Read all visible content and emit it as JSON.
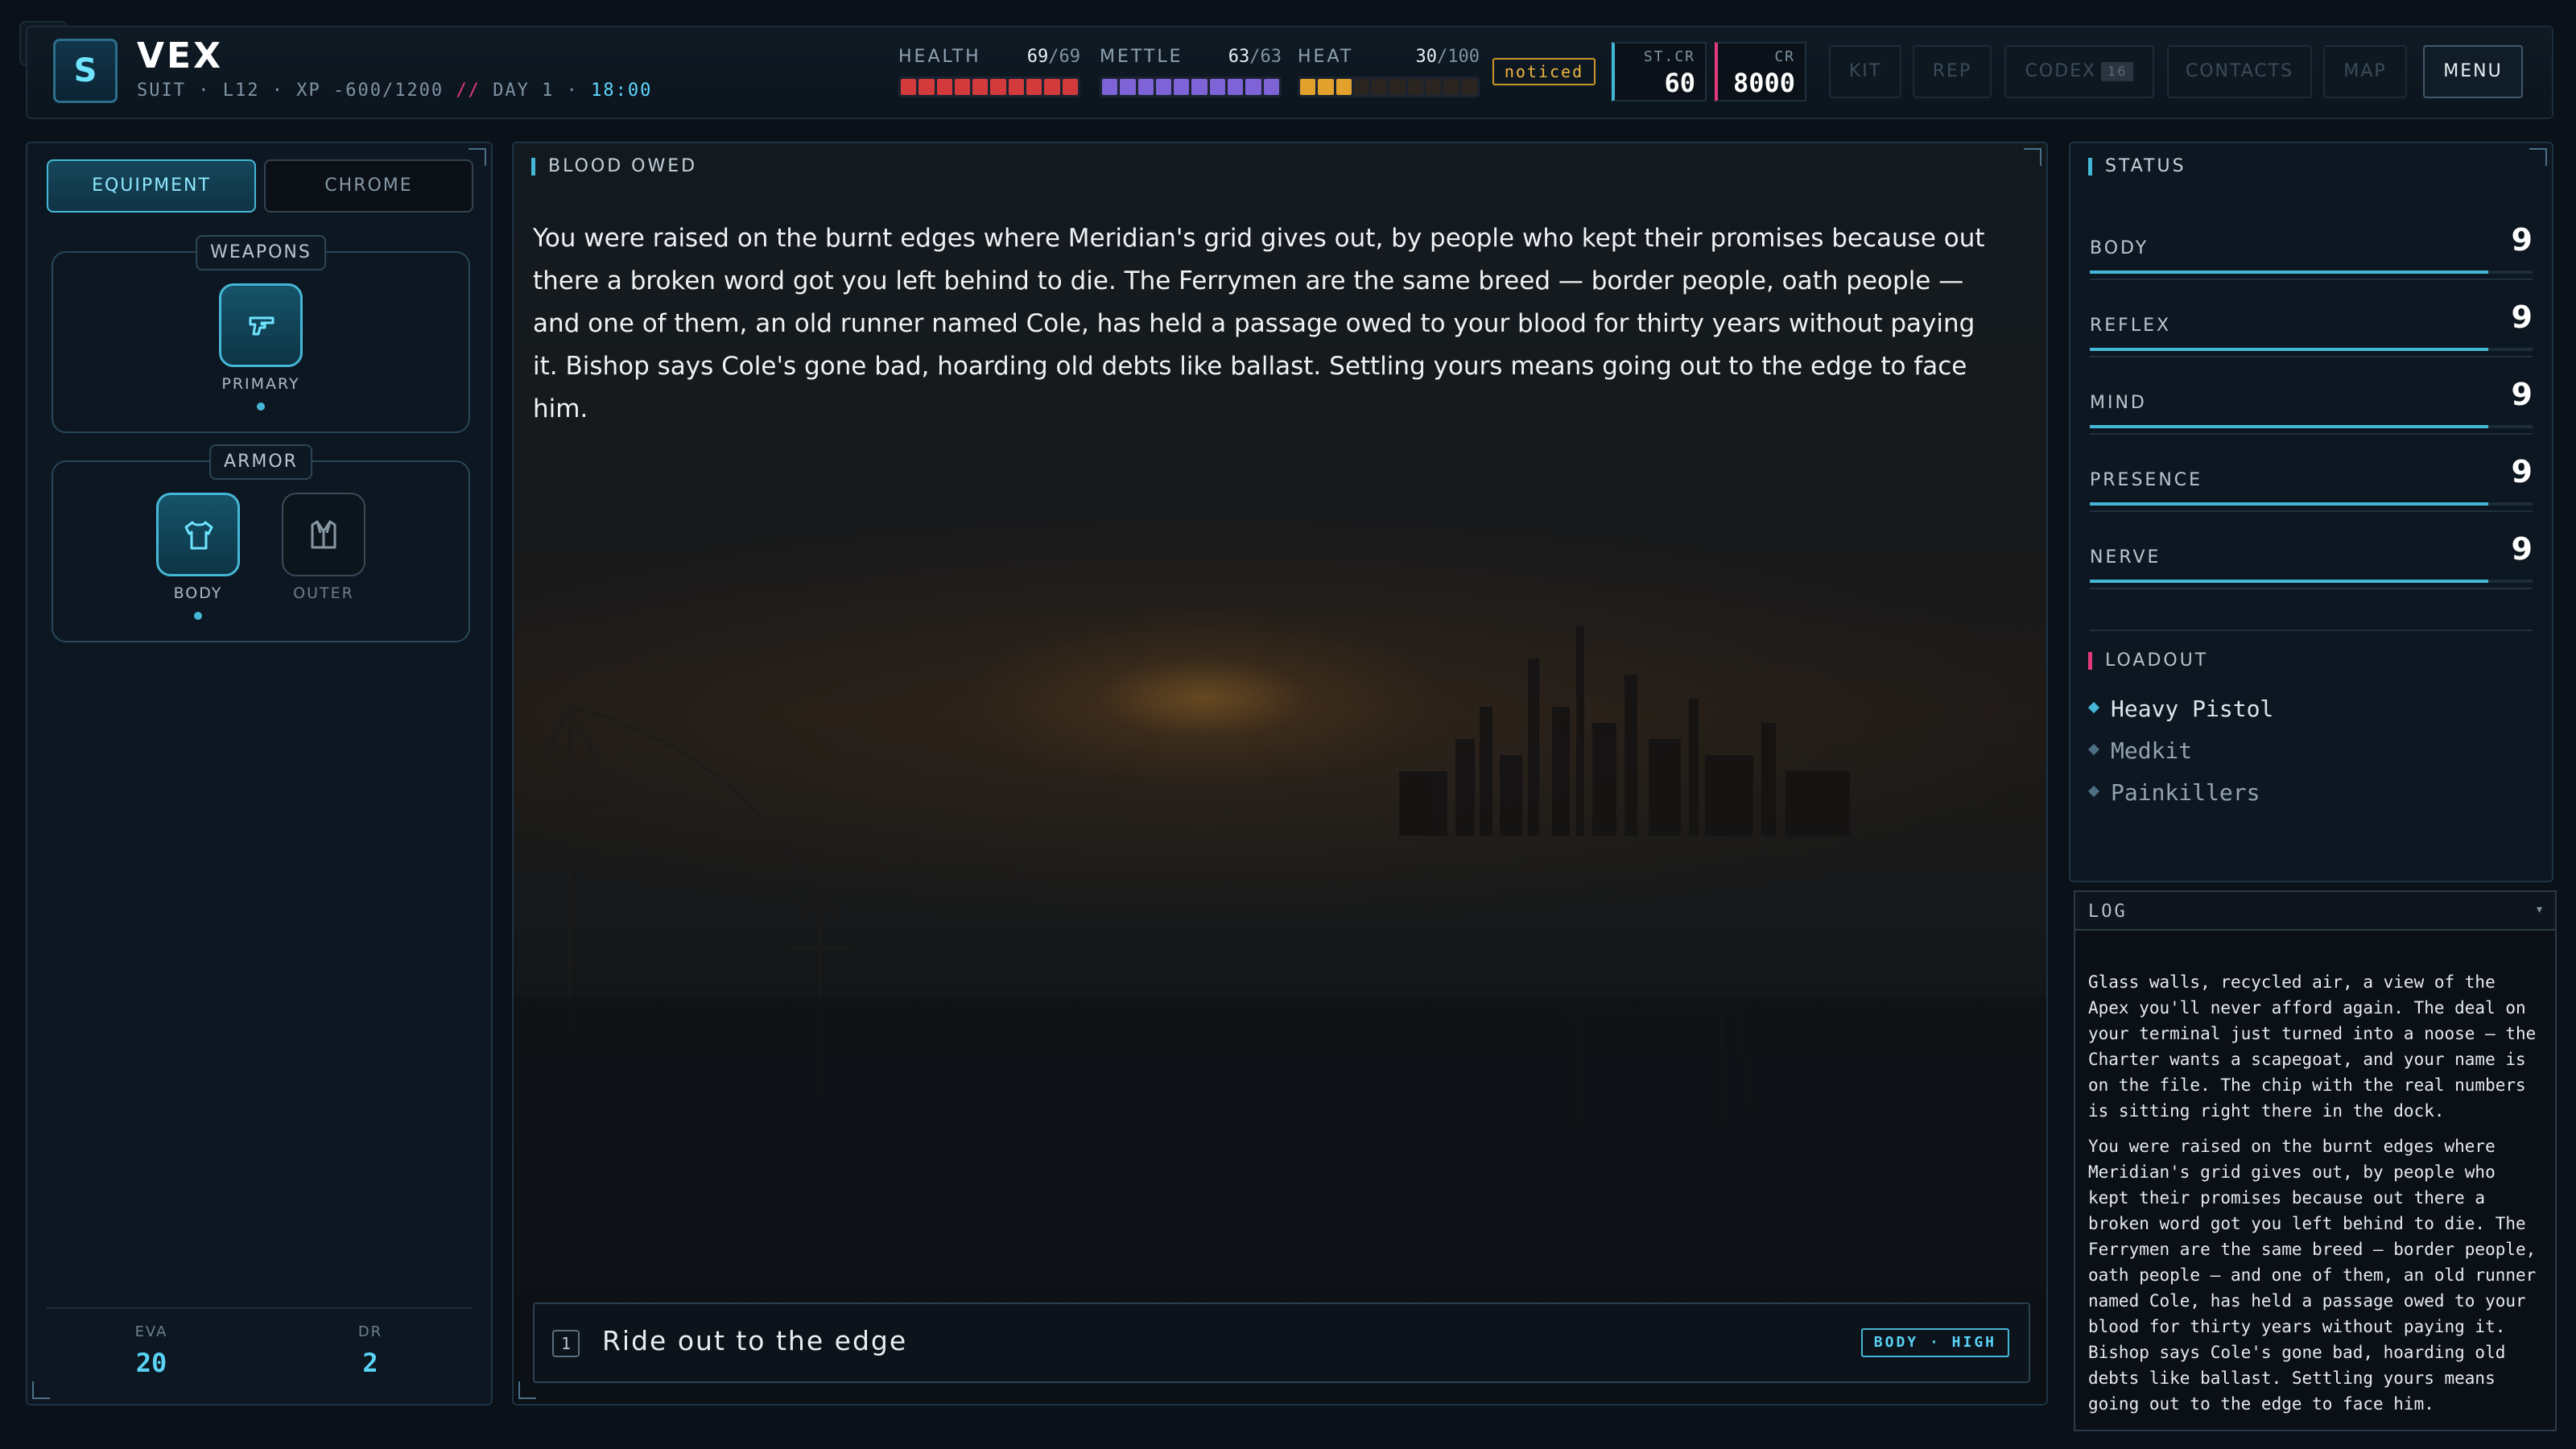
{
  "header": {
    "bug_icon": "bug-icon",
    "logo_letter": "S",
    "name": "VEX",
    "meta": {
      "class": "SUIT",
      "level": "L12",
      "xp": "XP -600/1200",
      "slashes": "//",
      "day": "DAY 1",
      "time": "18:00",
      "sep": "·"
    },
    "meters": [
      {
        "label": "HEALTH",
        "current": "69",
        "max": "/69",
        "fill": 1.0,
        "color": "#d23a3c"
      },
      {
        "label": "METTLE",
        "current": "63",
        "max": "/63",
        "fill": 1.0,
        "color": "#7d63d6"
      },
      {
        "label": "HEAT",
        "current": "30",
        "max": "/100",
        "fill": 0.3,
        "color": "#e2a12b"
      }
    ],
    "heat_status": "noticed",
    "street_cred": {
      "label": "ST.CR",
      "value": "60",
      "accent": "#45b7d6"
    },
    "credits": {
      "label": "CR",
      "value": "8000",
      "accent": "#e23a7a"
    },
    "nav": {
      "kit": "KIT",
      "rep": "REP",
      "codex": "CODEX",
      "codex_count": "16",
      "contacts": "CONTACTS",
      "map": "MAP",
      "menu": "MENU"
    }
  },
  "equipment": {
    "tabs": {
      "equipment": "EQUIPMENT",
      "chrome": "CHROME"
    },
    "weapons": {
      "title": "WEAPONS",
      "primary_label": "PRIMARY"
    },
    "armor": {
      "title": "ARMOR",
      "body_label": "BODY",
      "outer_label": "OUTER"
    },
    "stats": {
      "eva_label": "EVA",
      "eva_value": "20",
      "dr_label": "DR",
      "dr_value": "2"
    }
  },
  "scene": {
    "title": "BLOOD OWED",
    "narrative": "You were raised on the burnt edges where Meridian's grid gives out, by people who kept their promises because out there a broken word got you left behind to die. The Ferrymen are the same breed — border people, oath people — and one of them, an old runner named Cole, has held a passage owed to your blood for thirty years without paying it. Bishop says Cole's gone bad, hoarding old debts like ballast. Settling yours means going out to the edge to face him.",
    "choices": [
      {
        "number": "1",
        "text": "Ride out to the edge",
        "tag": "BODY · HIGH"
      }
    ]
  },
  "status": {
    "title": "STATUS",
    "attributes": [
      {
        "label": "BODY",
        "value": "9",
        "fill": 0.9
      },
      {
        "label": "REFLEX",
        "value": "9",
        "fill": 0.9
      },
      {
        "label": "MIND",
        "value": "9",
        "fill": 0.9
      },
      {
        "label": "PRESENCE",
        "value": "9",
        "fill": 0.9
      },
      {
        "label": "NERVE",
        "value": "9",
        "fill": 0.9
      }
    ],
    "loadout_title": "LOADOUT",
    "loadout": [
      {
        "name": "Heavy Pistol",
        "equipped": true
      },
      {
        "name": "Medkit",
        "equipped": false
      },
      {
        "name": "Painkillers",
        "equipped": false
      }
    ]
  },
  "log": {
    "title": "LOG",
    "toggle": "▾",
    "entries": [
      "Glass walls, recycled air, a view of the Apex you'll never afford again. The deal on your terminal just turned into a noose — the Charter wants a scapegoat, and your name is on the file. The chip with the real numbers is sitting right there in the dock.",
      "You were raised on the burnt edges where Meridian's grid gives out, by people who kept their promises because out there a broken word got you left behind to die. The Ferrymen are the same breed — border people, oath people — and one of them, an old runner named Cole, has held a passage owed to your blood for thirty years without paying it. Bishop says Cole's gone bad, hoarding old debts like ballast. Settling yours means going out to the edge to face him."
    ]
  }
}
